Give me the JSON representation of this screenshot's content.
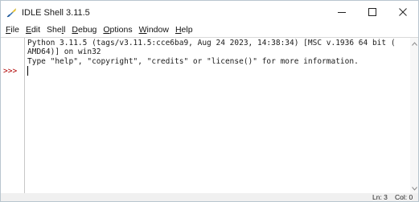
{
  "window": {
    "title": "IDLE Shell 3.11.5",
    "controls": {
      "minimize_glyph": "–",
      "maximize_glyph": "☐",
      "close_glyph": "✕"
    }
  },
  "menu": {
    "items": [
      {
        "label": "File",
        "underline": "F",
        "rest": "ile"
      },
      {
        "label": "Edit",
        "underline": "E",
        "rest": "dit"
      },
      {
        "label": "Shell",
        "pre": "She",
        "underline": "l",
        "rest": "l"
      },
      {
        "label": "Debug",
        "underline": "D",
        "rest": "ebug"
      },
      {
        "label": "Options",
        "underline": "O",
        "rest": "ptions"
      },
      {
        "label": "Window",
        "underline": "W",
        "rest": "indow"
      },
      {
        "label": "Help",
        "underline": "H",
        "rest": "elp"
      }
    ]
  },
  "shell": {
    "output_lines": [
      "Python 3.11.5 (tags/v3.11.5:cce6ba9, Aug 24 2023, 14:38:34) [MSC v.1936 64 bit (",
      "AMD64)] on win32",
      "Type \"help\", \"copyright\", \"credits\" or \"license()\" for more information."
    ],
    "prompt": ">>>"
  },
  "status": {
    "line": "Ln: 3",
    "col": "Col: 0"
  },
  "colors": {
    "prompt": "#b00000",
    "background": "#ffffff",
    "desktop": "#cfe3ee"
  },
  "icons": {
    "app": "idle-python-feather-icon",
    "scroll_up": "chevron-up-icon",
    "scroll_down": "chevron-down-icon"
  }
}
